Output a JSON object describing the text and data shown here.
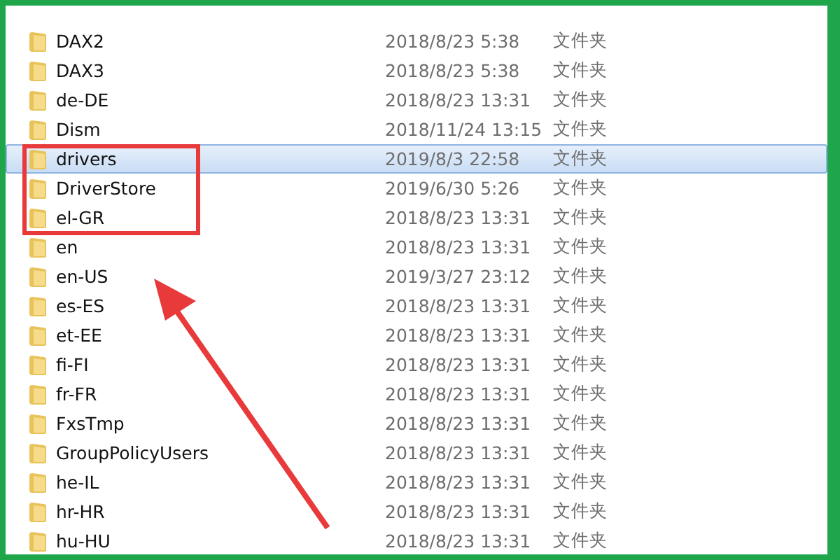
{
  "files": [
    {
      "name": "DAX2",
      "modified": "2018/8/23 5:38",
      "type": "文件夹",
      "selected": false
    },
    {
      "name": "DAX3",
      "modified": "2018/8/23 5:38",
      "type": "文件夹",
      "selected": false
    },
    {
      "name": "de-DE",
      "modified": "2018/8/23 13:31",
      "type": "文件夹",
      "selected": false
    },
    {
      "name": "Dism",
      "modified": "2018/11/24 13:15",
      "type": "文件夹",
      "selected": false
    },
    {
      "name": "drivers",
      "modified": "2019/8/3 22:58",
      "type": "文件夹",
      "selected": true
    },
    {
      "name": "DriverStore",
      "modified": "2019/6/30 5:26",
      "type": "文件夹",
      "selected": false
    },
    {
      "name": "el-GR",
      "modified": "2018/8/23 13:31",
      "type": "文件夹",
      "selected": false
    },
    {
      "name": "en",
      "modified": "2018/8/23 13:31",
      "type": "文件夹",
      "selected": false
    },
    {
      "name": "en-US",
      "modified": "2019/3/27 23:12",
      "type": "文件夹",
      "selected": false
    },
    {
      "name": "es-ES",
      "modified": "2018/8/23 13:31",
      "type": "文件夹",
      "selected": false
    },
    {
      "name": "et-EE",
      "modified": "2018/8/23 13:31",
      "type": "文件夹",
      "selected": false
    },
    {
      "name": "fi-FI",
      "modified": "2018/8/23 13:31",
      "type": "文件夹",
      "selected": false
    },
    {
      "name": "fr-FR",
      "modified": "2018/8/23 13:31",
      "type": "文件夹",
      "selected": false
    },
    {
      "name": "FxsTmp",
      "modified": "2018/8/23 13:31",
      "type": "文件夹",
      "selected": false
    },
    {
      "name": "GroupPolicyUsers",
      "modified": "2018/8/23 13:31",
      "type": "文件夹",
      "selected": false
    },
    {
      "name": "he-IL",
      "modified": "2018/8/23 13:31",
      "type": "文件夹",
      "selected": false
    },
    {
      "name": "hr-HR",
      "modified": "2018/8/23 13:31",
      "type": "文件夹",
      "selected": false
    },
    {
      "name": "hu-HU",
      "modified": "2018/8/23 13:31",
      "type": "文件夹",
      "selected": false
    }
  ]
}
